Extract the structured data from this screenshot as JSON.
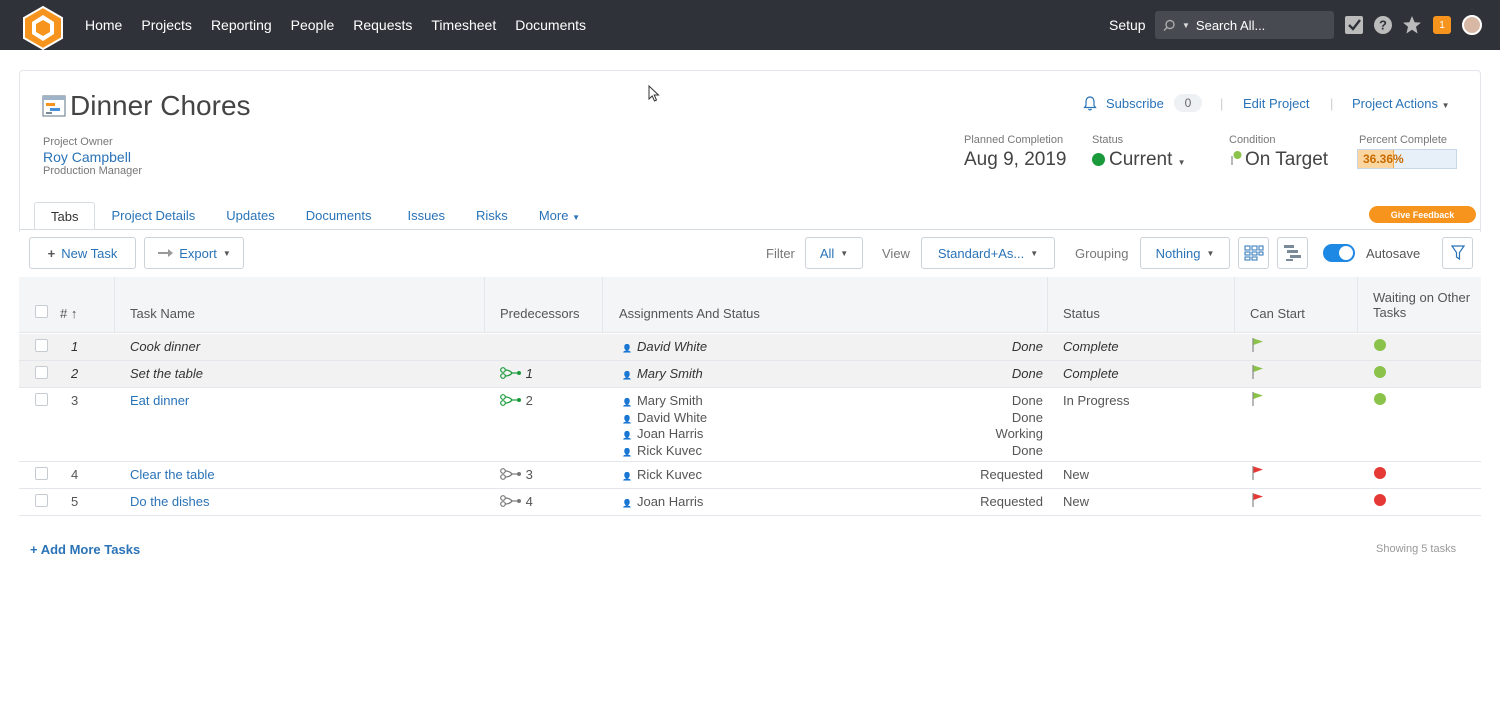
{
  "nav": {
    "items": [
      "Home",
      "Projects",
      "Reporting",
      "People",
      "Requests",
      "Timesheet",
      "Documents"
    ],
    "setup": "Setup",
    "search_placeholder": "Search All...",
    "notification_count": "1"
  },
  "project": {
    "title": "Dinner Chores",
    "owner_label": "Project Owner",
    "owner_name": "Roy Campbell",
    "owner_role": "Production Manager",
    "subscribe": "Subscribe",
    "subscribe_count": "0",
    "edit": "Edit Project",
    "actions": "Project Actions",
    "planned_label": "Planned Completion",
    "planned_value": "Aug 9, 2019",
    "status_label": "Status",
    "status_value": "Current",
    "condition_label": "Condition",
    "condition_value": "On Target",
    "percent_label": "Percent Complete",
    "percent_value": "36.36%",
    "percent_fraction": 0.3636,
    "status_color": "#1a9a3b"
  },
  "tabs": [
    {
      "label": "Tabs",
      "active": true
    },
    {
      "label": "Project Details"
    },
    {
      "label": "Updates"
    },
    {
      "label": "Documents"
    },
    {
      "label": "Issues"
    },
    {
      "label": "Risks"
    },
    {
      "label": "More"
    }
  ],
  "feedback": "Give Feedback",
  "toolbar": {
    "new_task": "New Task",
    "export": "Export",
    "filter_label": "Filter",
    "filter_value": "All",
    "view_label": "View",
    "view_value": "Standard+As...",
    "grouping_label": "Grouping",
    "grouping_value": "Nothing",
    "autosave": "Autosave"
  },
  "columns": {
    "num": "#",
    "name": "Task Name",
    "pred": "Predecessors",
    "assign": "Assignments And Status",
    "status": "Status",
    "can_start": "Can Start",
    "waiting": "Waiting on Other Tasks"
  },
  "tasks": [
    {
      "num": "1",
      "name": "Cook dinner",
      "pred": "",
      "people": [
        "David White"
      ],
      "states": [
        "Done"
      ],
      "status": "Complete",
      "done": true,
      "can_start": "green",
      "waiting": "green"
    },
    {
      "num": "2",
      "name": "Set the table",
      "pred": "1",
      "pred_green": true,
      "people": [
        "Mary Smith"
      ],
      "states": [
        "Done"
      ],
      "status": "Complete",
      "done": true,
      "can_start": "green",
      "waiting": "green"
    },
    {
      "num": "3",
      "name": "Eat dinner",
      "pred": "2",
      "pred_green": true,
      "people": [
        "Mary Smith",
        "David White",
        "Joan Harris",
        "Rick Kuvec"
      ],
      "states": [
        "Done",
        "Done",
        "Working",
        "Done"
      ],
      "status": "In Progress",
      "done": false,
      "can_start": "green",
      "waiting": "green"
    },
    {
      "num": "4",
      "name": "Clear the table",
      "pred": "3",
      "pred_green": false,
      "people": [
        "Rick Kuvec"
      ],
      "states": [
        "Requested"
      ],
      "status": "New",
      "done": false,
      "can_start": "red",
      "waiting": "red"
    },
    {
      "num": "5",
      "name": "Do the dishes",
      "pred": "4",
      "pred_green": false,
      "people": [
        "Joan Harris"
      ],
      "states": [
        "Requested"
      ],
      "status": "New",
      "done": false,
      "can_start": "red",
      "waiting": "red"
    }
  ],
  "footer": {
    "add_more": "+ Add More Tasks",
    "showing": "Showing 5 tasks"
  },
  "colors": {
    "accent": "#2a73b7",
    "orange": "#f7941d",
    "green": "#8bc34a",
    "red": "#e53935"
  }
}
